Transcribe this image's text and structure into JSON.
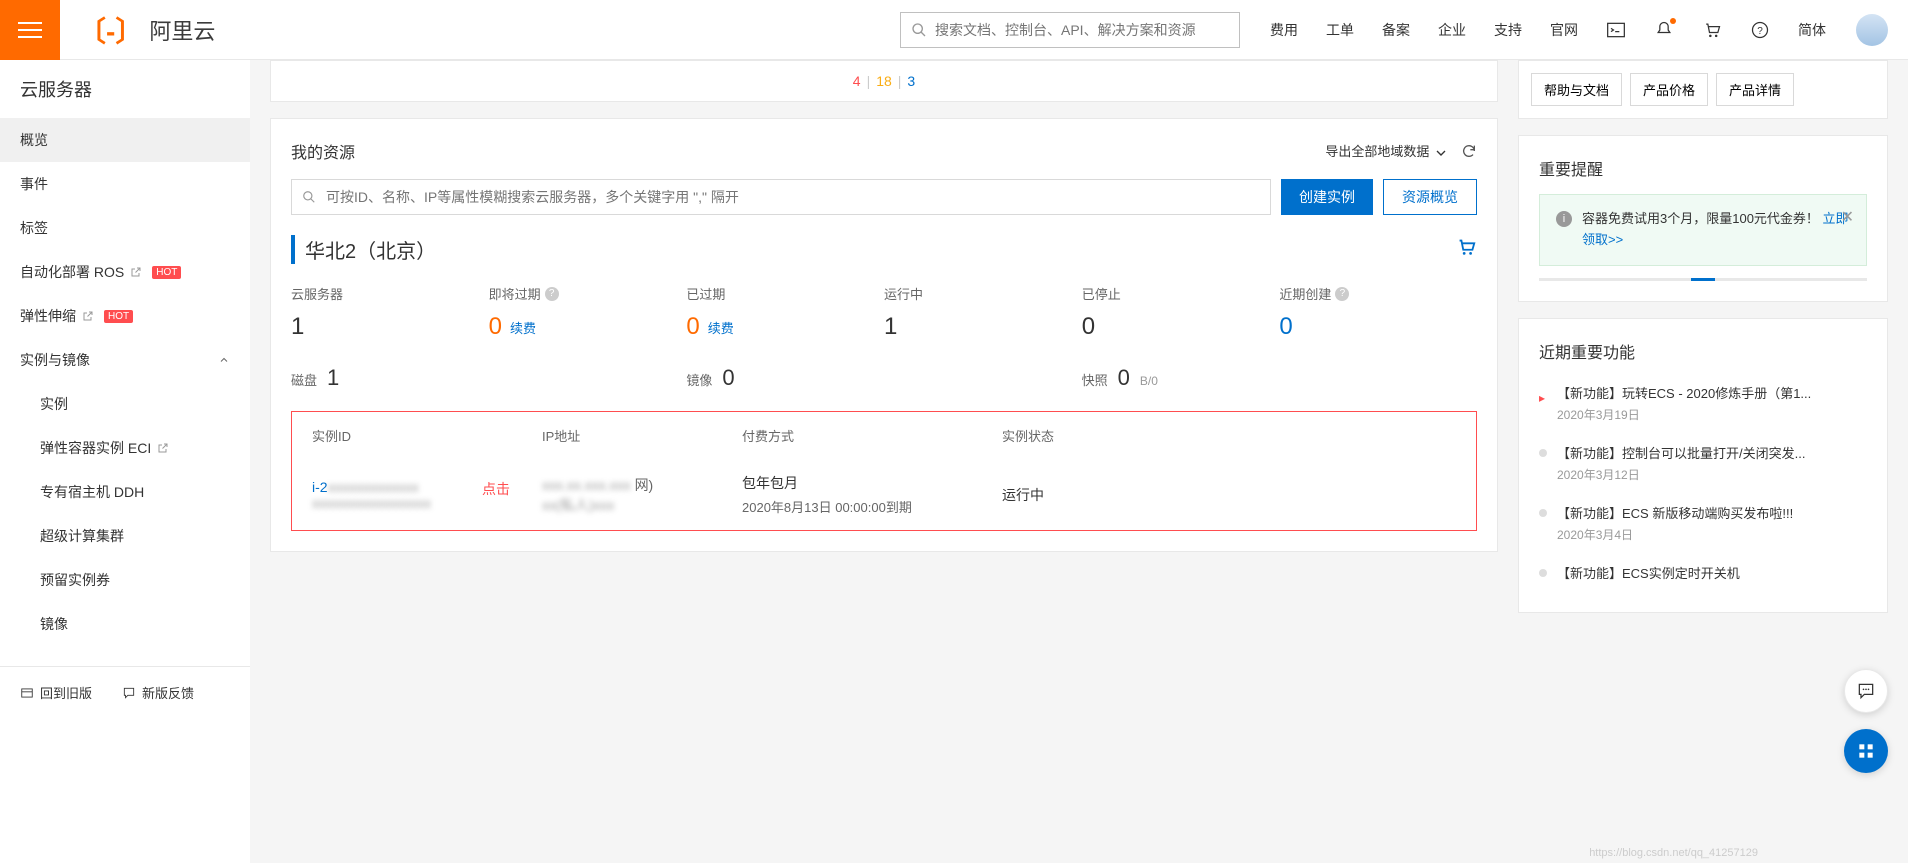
{
  "header": {
    "logo": "阿里云",
    "search_placeholder": "搜索文档、控制台、API、解决方案和资源",
    "nav": [
      "费用",
      "工单",
      "备案",
      "企业",
      "支持",
      "官网"
    ],
    "lang": "简体"
  },
  "sidebar": {
    "title": "云服务器",
    "items": [
      {
        "label": "概览",
        "active": true
      },
      {
        "label": "事件"
      },
      {
        "label": "标签"
      },
      {
        "label": "自动化部署 ROS",
        "ext": true,
        "hot": true
      },
      {
        "label": "弹性伸缩",
        "ext": true,
        "hot": true
      }
    ],
    "group": {
      "label": "实例与镜像"
    },
    "subs": [
      {
        "label": "实例"
      },
      {
        "label": "弹性容器实例 ECI",
        "ext": true
      },
      {
        "label": "专有宿主机 DDH"
      },
      {
        "label": "超级计算集群"
      },
      {
        "label": "预留实例券"
      },
      {
        "label": "镜像"
      }
    ],
    "footer": {
      "back": "回到旧版",
      "feedback": "新版反馈"
    }
  },
  "top_numbers": {
    "a": "4",
    "b": "18",
    "c": "3"
  },
  "top_buttons": [
    "帮助与文档",
    "产品价格",
    "产品详情"
  ],
  "resources": {
    "title": "我的资源",
    "export": "导出全部地域数据",
    "search_placeholder": "可按ID、名称、IP等属性模糊搜索云服务器，多个关键字用 \",\" 隔开",
    "create_btn": "创建实例",
    "overview_btn": "资源概览",
    "region": "华北2（北京）",
    "stats": [
      {
        "label": "云服务器",
        "value": "1"
      },
      {
        "label": "即将过期",
        "value": "0",
        "renew": "续费",
        "help": true,
        "color": "orange"
      },
      {
        "label": "已过期",
        "value": "0",
        "renew": "续费",
        "color": "orange"
      },
      {
        "label": "运行中",
        "value": "1"
      },
      {
        "label": "已停止",
        "value": "0"
      },
      {
        "label": "近期创建",
        "value": "0",
        "help": true,
        "color": "blue"
      }
    ],
    "disks": [
      {
        "label": "磁盘",
        "value": "1"
      },
      {
        "label": "镜像",
        "value": "0"
      },
      {
        "label": "快照",
        "value": "0",
        "sub": "B/0"
      }
    ],
    "table": {
      "cols": [
        "实例ID",
        "IP地址",
        "付费方式",
        "实例状态"
      ],
      "row": {
        "id_prefix": "i-2",
        "click_hint": "点击",
        "ip_mask": "网)",
        "pay_type": "包年包月",
        "pay_expire": "2020年8月13日 00:00:00到期",
        "status": "运行中"
      }
    }
  },
  "alerts": {
    "title": "重要提醒",
    "text": "容器免费试用3个月，限量100元代金券！",
    "link": "立即领取>>"
  },
  "news": {
    "title": "近期重要功能",
    "items": [
      {
        "title": "【新功能】玩转ECS - 2020修炼手册（第1...",
        "date": "2020年3月19日",
        "hot": true
      },
      {
        "title": "【新功能】控制台可以批量打开/关闭突发...",
        "date": "2020年3月12日"
      },
      {
        "title": "【新功能】ECS 新版移动端购买发布啦!!!",
        "date": "2020年3月4日"
      },
      {
        "title": "【新功能】ECS实例定时开关机",
        "date": ""
      }
    ]
  },
  "watermark": "https://blog.csdn.net/qq_41257129"
}
